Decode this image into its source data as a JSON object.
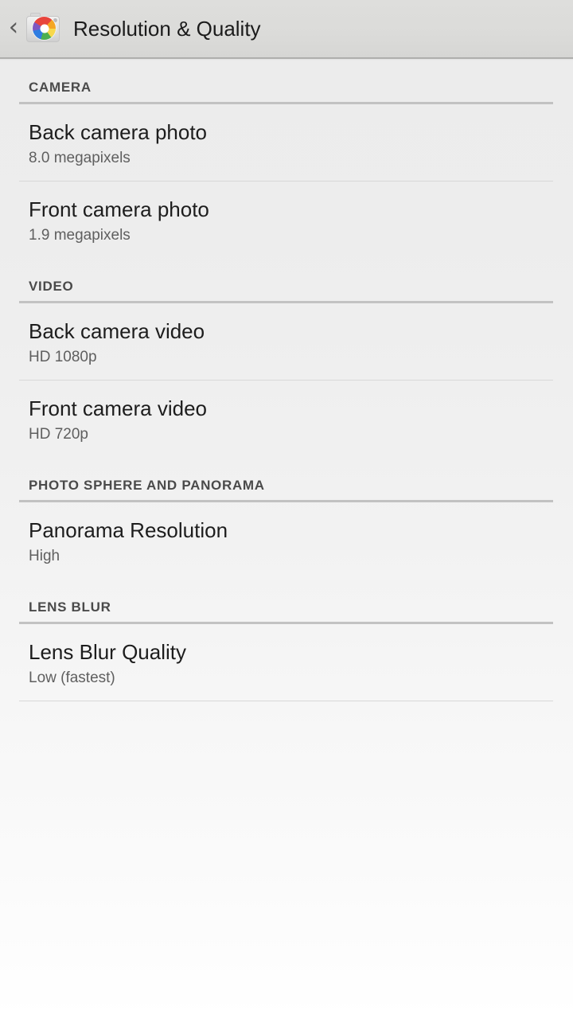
{
  "action_bar": {
    "back_label": "‹",
    "app_icon": "camera-app-icon",
    "title": "Resolution & Quality"
  },
  "colors": {
    "bar_background": "#dbdbd9",
    "title_text": "#1b1b1b",
    "section_header_text": "#4a4a4a",
    "item_title_text": "#1d1d1d",
    "item_summary_text": "#5f5f5f",
    "section_divider": "#c2c2c2",
    "item_divider": "#d8d8d8",
    "icon_red": "#e8453c",
    "icon_orange": "#f5a623",
    "icon_yellow": "#f7d84b",
    "icon_green": "#4caf50",
    "icon_blue": "#2f7de1",
    "icon_purple": "#7e57c2"
  },
  "sections": [
    {
      "header": "CAMERA",
      "items": [
        {
          "title": "Back camera photo",
          "summary": "8.0 megapixels"
        },
        {
          "title": "Front camera photo",
          "summary": "1.9 megapixels"
        }
      ]
    },
    {
      "header": "VIDEO",
      "items": [
        {
          "title": "Back camera video",
          "summary": "HD 1080p"
        },
        {
          "title": "Front camera video",
          "summary": "HD 720p"
        }
      ]
    },
    {
      "header": "PHOTO SPHERE AND PANORAMA",
      "items": [
        {
          "title": "Panorama Resolution",
          "summary": "High"
        }
      ]
    },
    {
      "header": "LENS BLUR",
      "items": [
        {
          "title": "Lens Blur Quality",
          "summary": "Low (fastest)"
        }
      ]
    }
  ]
}
